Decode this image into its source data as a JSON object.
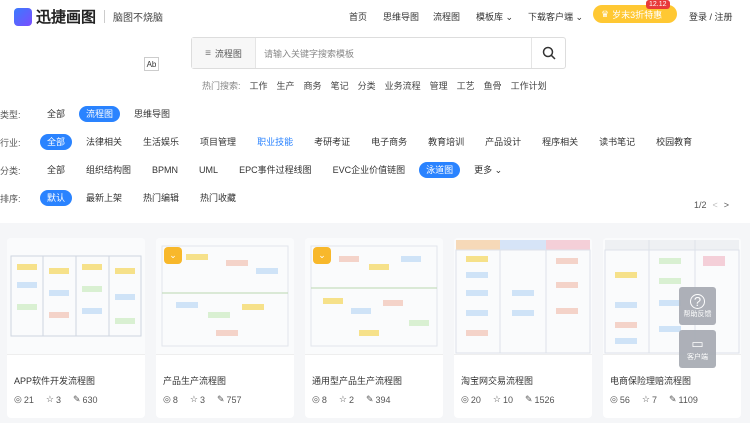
{
  "header": {
    "brand": "迅捷画图",
    "slogan": "脑图不烧脑",
    "nav": [
      "首页",
      "思维导图",
      "流程图",
      "模板库",
      "下载客户端"
    ],
    "promo": "岁末3折特惠",
    "promo_badge": "12.12",
    "auth": "登录 / 注册"
  },
  "search": {
    "type_label": "流程图",
    "placeholder": "请输入关键字搜索模板",
    "cap_label": "Ab"
  },
  "hot": {
    "label": "热门搜索:",
    "terms": [
      "工作",
      "生产",
      "商务",
      "笔记",
      "分类",
      "业务流程",
      "管理",
      "工艺",
      "鱼骨",
      "工作计划"
    ]
  },
  "filters": {
    "type": {
      "label": "类型:",
      "chips": [
        "全部",
        "流程图",
        "思维导图"
      ]
    },
    "industry": {
      "label": "行业:",
      "chips": [
        "全部",
        "法律相关",
        "生活娱乐",
        "项目管理",
        "职业技能",
        "考研考证",
        "电子商务",
        "教育培训",
        "产品设计",
        "程序相关",
        "读书笔记",
        "校园教育"
      ]
    },
    "category": {
      "label": "分类:",
      "chips": [
        "全部",
        "组织结构图",
        "BPMN",
        "UML",
        "EPC事件过程线图",
        "EVC企业价值链图",
        "泳道图",
        "更多"
      ]
    },
    "sort": {
      "label": "排序:",
      "chips": [
        "默认",
        "最新上架",
        "热门编辑",
        "热门收藏"
      ]
    }
  },
  "pager": {
    "text": "1/2",
    "prev": "<",
    "next": ">"
  },
  "cards": [
    {
      "title": "APP软件开发流程图",
      "views": "21",
      "likes": "3",
      "edits": "630",
      "vip": false
    },
    {
      "title": "产品生产流程图",
      "views": "8",
      "likes": "3",
      "edits": "757",
      "vip": true
    },
    {
      "title": "通用型产品生产流程图",
      "views": "8",
      "likes": "2",
      "edits": "394",
      "vip": true
    },
    {
      "title": "淘宝网交易流程图",
      "views": "20",
      "likes": "10",
      "edits": "1526",
      "vip": false
    },
    {
      "title": "电商保险理赔流程图",
      "views": "56",
      "likes": "7",
      "edits": "1109",
      "vip": false
    }
  ],
  "side_buttons": {
    "feedback": "帮助反馈",
    "client": "客户端"
  },
  "colors": {
    "accent": "#2a83ff",
    "promo": "#ffc833",
    "vip": "#f8b82b"
  }
}
